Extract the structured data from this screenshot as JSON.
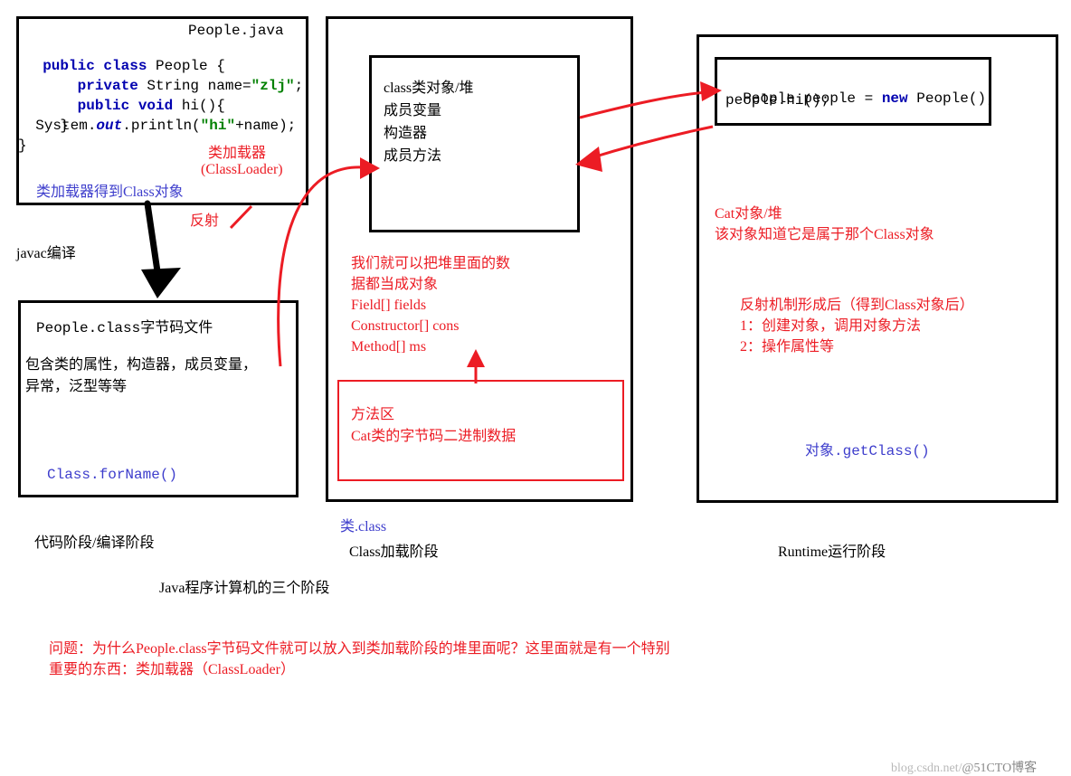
{
  "file_label": "People.java",
  "code_source": {
    "l1_a": "public class ",
    "l1_b": "People {",
    "l2_a": "    private ",
    "l2_b": "String name=",
    "l2_c": "\"zlj\"",
    "l2_d": ";",
    "l3_a": "    public void ",
    "l3_b": "hi(){",
    "l4_a": "System.",
    "l4_b": "out",
    "l4_c": ".println(",
    "l4_d": "\"hi\"",
    "l4_e": "+name);",
    "l5": "    }",
    "l6": "}"
  },
  "annot": {
    "classloader_title": "类加载器",
    "classloader_en": "(ClassLoader)",
    "classloader_gets": "类加载器得到Class对象",
    "reflect": "反射",
    "javac": "javac编译"
  },
  "bytecode_box": {
    "title": "People.class字节码文件",
    "body": "包含类的属性，构造器，成员变量，\n异常，泛型等等",
    "forName": "Class.forName()"
  },
  "stage1_label": "代码阶段/编译阶段",
  "heap_box": {
    "l1": "class类对象/堆",
    "l2": "成员变量",
    "l3": "构造器",
    "l4": "成员方法"
  },
  "heap_explain": "我们就可以把堆里面的数\n据都当成对象\nField[] fields\nConstructor[] cons\nMethod[] ms",
  "method_area": {
    "l1": "方法区",
    "l2": "Cat类的字节码二进制数据"
  },
  "class_label_blue": "类.class",
  "stage2_label": "Class加载阶段",
  "runtime_code": {
    "l1_a": "People people = ",
    "l1_b": "new ",
    "l1_c": "People();",
    "l2": "people.hi();"
  },
  "cat_note": "Cat对象/堆\n该对象知道它是属于那个Class对象",
  "reflect_after": "反射机制形成后（得到Class对象后）\n1：创建对象，调用对象方法\n2：操作属性等",
  "getClass": "对象.getClass()",
  "stage3_label": "Runtime运行阶段",
  "three_stages": "Java程序计算机的三个阶段",
  "question": "问题：为什么People.class字节码文件就可以放入到类加载阶段的堆里面呢？这里面就是有一个特别\n重要的东西：类加载器（ClassLoader）",
  "watermark": "blog.csdn.net/",
  "watermark2": "@51CTO博客"
}
